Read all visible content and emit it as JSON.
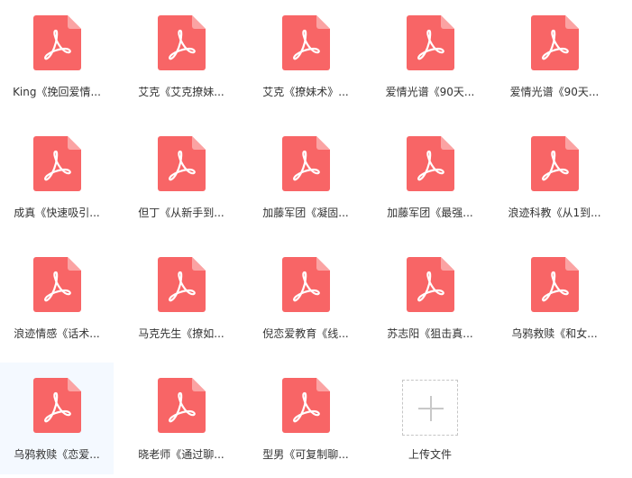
{
  "colors": {
    "pdf_icon_red": "#f86566",
    "pdf_icon_fold": "#fba3a3",
    "pdf_glyph": "#ffffff",
    "selected_background": "#f4f9ff",
    "text": "#333333",
    "upload_border": "#c6c6c6",
    "upload_plus": "#c8c8c8"
  },
  "files": [
    {
      "name": "King《挽回爱情...",
      "icon": "pdf-file-icon"
    },
    {
      "name": "艾克《艾克撩妹...",
      "icon": "pdf-file-icon"
    },
    {
      "name": "艾克《撩妹术》...",
      "icon": "pdf-file-icon"
    },
    {
      "name": "爱情光谱《90天...",
      "icon": "pdf-file-icon"
    },
    {
      "name": "爱情光谱《90天...",
      "icon": "pdf-file-icon"
    },
    {
      "name": "成真《快速吸引...",
      "icon": "pdf-file-icon"
    },
    {
      "name": "但丁《从新手到...",
      "icon": "pdf-file-icon"
    },
    {
      "name": "加藤军团《凝固...",
      "icon": "pdf-file-icon"
    },
    {
      "name": "加藤军团《最强...",
      "icon": "pdf-file-icon"
    },
    {
      "name": "浪迹科教《从1到...",
      "icon": "pdf-file-icon"
    },
    {
      "name": "浪迹情感《话术...",
      "icon": "pdf-file-icon"
    },
    {
      "name": "马克先生《撩如...",
      "icon": "pdf-file-icon"
    },
    {
      "name": "倪恋爱教育《线...",
      "icon": "pdf-file-icon"
    },
    {
      "name": "苏志阳《狙击真...",
      "icon": "pdf-file-icon"
    },
    {
      "name": "乌鸦救赎《和女...",
      "icon": "pdf-file-icon"
    },
    {
      "name": "乌鸦救赎《恋爱...",
      "icon": "pdf-file-icon",
      "selected": true
    },
    {
      "name": "晓老师《通过聊...",
      "icon": "pdf-file-icon"
    },
    {
      "name": "型男《可复制聊...",
      "icon": "pdf-file-icon"
    }
  ],
  "upload": {
    "label": "上传文件",
    "icon": "plus-icon"
  }
}
